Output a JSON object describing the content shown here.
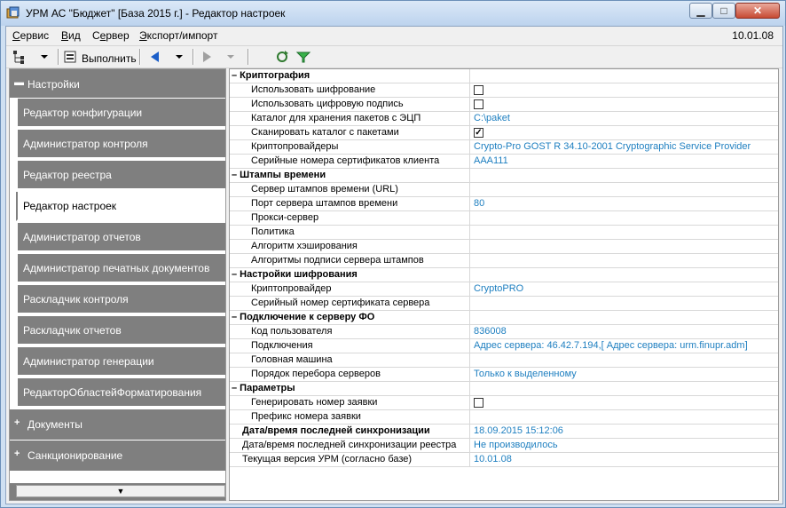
{
  "window": {
    "title": "УРМ АС \"Бюджет\" [База 2015 г.] - Редактор настроек"
  },
  "menu": {
    "items": [
      {
        "prefix": "",
        "u": "С",
        "rest": "ервис"
      },
      {
        "prefix": "",
        "u": "В",
        "rest": "ид"
      },
      {
        "prefix": "С",
        "u": "е",
        "rest": "рвер"
      },
      {
        "prefix": "",
        "u": "Э",
        "rest": "кспорт/импорт"
      }
    ],
    "date": "10.01.08"
  },
  "toolbar": {
    "run_label": "Выполнить"
  },
  "sidebar": {
    "header": "Настройки",
    "items": [
      "Редактор конфигурации",
      "Администратор контроля",
      "Редактор реестра",
      "Редактор настроек",
      "Администратор отчетов",
      "Администратор печатных документов",
      "Раскладчик контроля",
      "Раскладчик отчетов",
      "Администратор генерации",
      "РедакторОбластейФорматирования"
    ],
    "groups": [
      "Документы",
      "Санкционирование"
    ]
  },
  "settings": [
    {
      "type": "section",
      "name": "Криптография"
    },
    {
      "type": "sub",
      "name": "Использовать шифрование",
      "check": ""
    },
    {
      "type": "sub",
      "name": "Использовать цифровую подпись",
      "check": ""
    },
    {
      "type": "sub",
      "name": "Каталог для хранения пакетов с ЭЦП",
      "value": "C:\\paket"
    },
    {
      "type": "sub",
      "name": "Сканировать каталог с пакетами",
      "check": "✓"
    },
    {
      "type": "sub",
      "name": "Криптопровайдеры",
      "value": "Crypto-Pro GOST R 34.10-2001 Cryptographic Service Provider"
    },
    {
      "type": "sub",
      "name": "Серийные номера сертификатов  клиента",
      "value": "AAA111"
    },
    {
      "type": "section",
      "name": "Штампы времени"
    },
    {
      "type": "sub",
      "name": "Сервер штампов времени (URL)",
      "value": ""
    },
    {
      "type": "sub",
      "name": "Порт сервера штампов времени",
      "value": "80"
    },
    {
      "type": "sub",
      "name": "Прокси-сервер",
      "value": ""
    },
    {
      "type": "sub",
      "name": "Политика",
      "value": ""
    },
    {
      "type": "sub",
      "name": "Алгоритм хэширования",
      "value": ""
    },
    {
      "type": "sub",
      "name": "Алгоритмы подписи сервера штампов",
      "value": ""
    },
    {
      "type": "section",
      "name": "Настройки шифрования"
    },
    {
      "type": "sub",
      "name": "Криптопровайдер",
      "value": "CryptoPRO"
    },
    {
      "type": "sub",
      "name": "Серийный номер сертификата сервера",
      "value": ""
    },
    {
      "type": "section",
      "name": "Подключение к серверу ФО"
    },
    {
      "type": "sub",
      "name": "Код пользователя",
      "value": "836008"
    },
    {
      "type": "sub",
      "name": "Подключения",
      "value": " Адрес сервера: 46.42.7.194,[ Адрес сервера: urm.finupr.adm]"
    },
    {
      "type": "sub",
      "name": "Головная машина",
      "value": ""
    },
    {
      "type": "sub",
      "name": "Порядок перебора серверов",
      "value": "Только к выделенному"
    },
    {
      "type": "section",
      "name": "Параметры"
    },
    {
      "type": "sub",
      "name": "Генерировать номер заявки",
      "check": ""
    },
    {
      "type": "sub",
      "name": "Префикс номера заявки",
      "value": ""
    },
    {
      "type": "topbold",
      "name": "Дата/время последней синхронизации",
      "value": "18.09.2015 15:12:06"
    },
    {
      "type": "top",
      "name": "Дата/время последней синхронизации реестра",
      "value": "Не производилось"
    },
    {
      "type": "top",
      "name": "Текущая версия УРМ (согласно базе)",
      "value": "10.01.08"
    }
  ]
}
